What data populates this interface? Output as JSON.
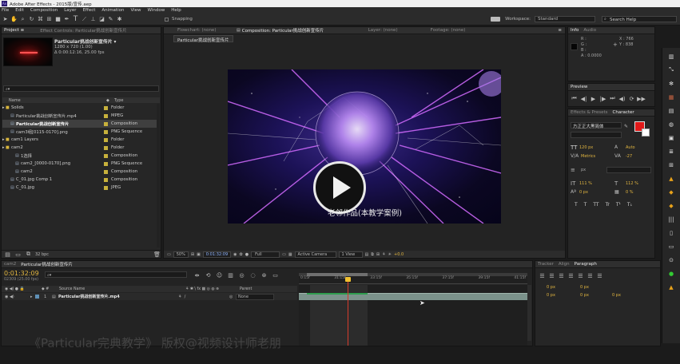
{
  "title_bar": {
    "title": "Adobe After Effects - 2015版/宣传.aep"
  },
  "menu": [
    "File",
    "Edit",
    "Composition",
    "Layer",
    "Effect",
    "Animation",
    "View",
    "Window",
    "Help"
  ],
  "toolbar": {
    "snapping": "Snapping",
    "workspace_label": "Workspace:",
    "workspace_value": "Standard",
    "search_placeholder": "Search Help"
  },
  "project": {
    "tab": "Project ≡",
    "effect_controls_tab": "Effect Controls: Particular挑战创新宣传片",
    "comp_name": "Particular挑战创新宣传片 ▾",
    "comp_meta1": "1280 x 720 (1.00)",
    "comp_meta2": "Δ 0:00:12:16, 25.00 fps",
    "columns": [
      "Name",
      "Type"
    ],
    "items": [
      {
        "indent": 0,
        "name": "Solids",
        "type": "Folder",
        "color": "#c7b13c",
        "selected": false,
        "folder": true
      },
      {
        "indent": 1,
        "name": "Particular挑战创新宣传片.mp4",
        "type": "MPEG",
        "color": "#c7b13c",
        "selected": false,
        "folder": false
      },
      {
        "indent": 1,
        "name": "Particular挑战创新宣传片",
        "type": "Composition",
        "color": "#c7b13c",
        "selected": true,
        "folder": false
      },
      {
        "indent": 1,
        "name": "cam3组[0115-0170].png",
        "type": "PNG Sequence",
        "color": "#c7b13c",
        "selected": false,
        "folder": false
      },
      {
        "indent": 0,
        "name": "cam1 Layers",
        "type": "Folder",
        "color": "#c7b13c",
        "selected": false,
        "folder": true
      },
      {
        "indent": 0,
        "name": "cam2",
        "type": "Folder",
        "color": "#c7b13c",
        "selected": false,
        "folder": true
      },
      {
        "indent": 2,
        "name": "1选择",
        "type": "Composition",
        "color": "#c7b13c",
        "selected": false,
        "folder": false
      },
      {
        "indent": 2,
        "name": "cam2_[0000-0170].png",
        "type": "PNG Sequence",
        "color": "#c7b13c",
        "selected": false,
        "folder": false
      },
      {
        "indent": 2,
        "name": "cam2",
        "type": "Composition",
        "color": "#c7b13c",
        "selected": false,
        "folder": false
      },
      {
        "indent": 1,
        "name": "C_01.jpg Comp 1",
        "type": "Composition",
        "color": "#c7b13c",
        "selected": false,
        "folder": false
      },
      {
        "indent": 1,
        "name": "C_01.jpg",
        "type": "JPEG",
        "color": "#c7b13c",
        "selected": false,
        "folder": false
      }
    ],
    "bpc": "32 bpc"
  },
  "viewer": {
    "tabs": [
      "Flowchart: (none)",
      "Composition: Particular挑战创新宣传片",
      "Layer: (none)",
      "Footage: (none)"
    ],
    "active_tab": "Composition: Particular挑战创新宣传片",
    "sub_tab": "Particular挑战创新宣传片",
    "caption": "老邻作品(本教学案例)",
    "zoom": "50%",
    "timecode": "0:01:32:09",
    "resolution": "Full",
    "camera": "Active Camera",
    "views": "1 View",
    "exposure": "+0.0"
  },
  "info": {
    "tabs": [
      "Info",
      "Audio"
    ],
    "r": "R :",
    "g": "G :",
    "b": "B :",
    "a": "A : 0.0000",
    "x": "X : 766",
    "y": "Y : 838"
  },
  "preview": {
    "tab": "Preview"
  },
  "character": {
    "tabs": [
      "Effects & Presets",
      "Character"
    ],
    "font_name": "方正正大黑简体",
    "font_size": "120 px",
    "leading": "Auto",
    "kerning": "Metrics",
    "tracking": "-27",
    "stroke": "px",
    "vscale": "111 %",
    "hscale": "112 %",
    "baseline": "0 px",
    "tsume": "0 %",
    "styles": [
      "T",
      "T",
      "TT",
      "Tr",
      "T¹",
      "T₁"
    ]
  },
  "timeline": {
    "tabs": [
      "cam2",
      "Particular挑战创新宣传片"
    ],
    "timecode": "0:01:32:09",
    "frames": "02309 (25.00 fps)",
    "col_source": "Source Name",
    "col_parent": "Parent",
    "layer_num": "1",
    "layer_name": "Particular挑战创新宣传片.mp4",
    "parent": "None",
    "ruler": [
      "0:15f",
      "31:15f",
      "33:15f",
      "35:15f",
      "37:15f",
      "39:15f",
      "41:15f"
    ]
  },
  "paragraph": {
    "tabs": [
      "Tracker",
      "Align",
      "Paragraph"
    ],
    "values": [
      "0 px",
      "0 px",
      "0 px",
      "0 px",
      "0 px"
    ]
  },
  "watermark": "《Particular完典教学》 版权@视频设计师老朋"
}
